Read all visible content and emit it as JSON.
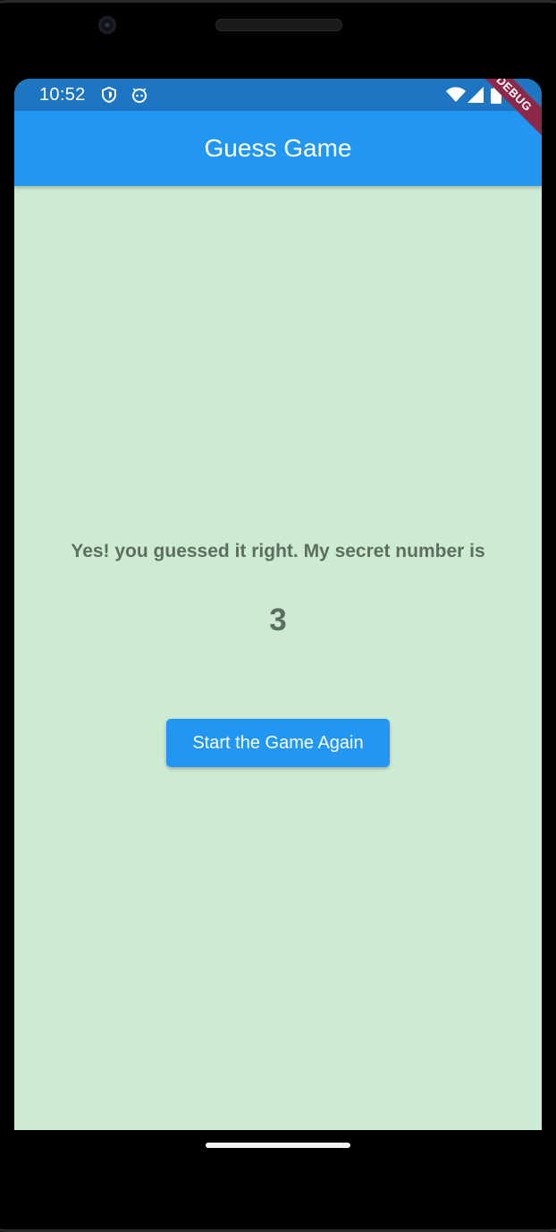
{
  "status_bar": {
    "time": "10:52",
    "left_icons": [
      "shield-icon",
      "android-face-icon"
    ],
    "right_icons": [
      "wifi-icon",
      "signal-icon",
      "battery-icon"
    ]
  },
  "app_bar": {
    "title": "Guess Game"
  },
  "debug_banner": {
    "label": "DEBUG"
  },
  "content": {
    "message": "Yes! you guessed it right. My secret number is",
    "secret_number": "3",
    "restart_button_label": "Start the Game Again"
  },
  "colors": {
    "app_bar": "#2196f3",
    "status_bar": "#1e76c2",
    "background": "#cdebd3",
    "text": "#5e6e5e",
    "debug_banner": "#8d2848"
  }
}
